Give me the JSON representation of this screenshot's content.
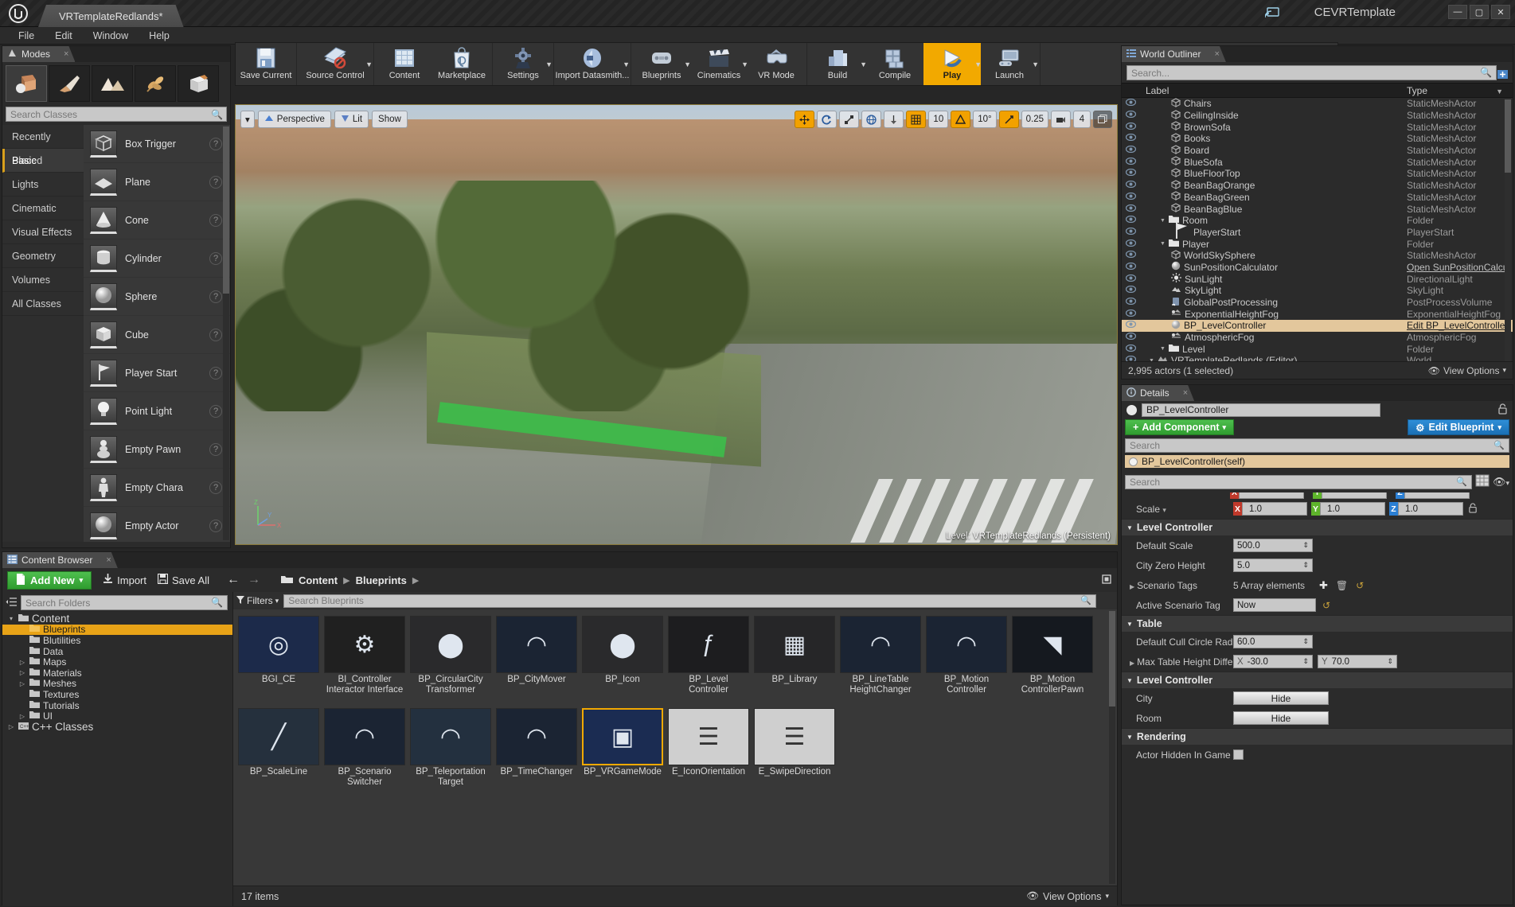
{
  "window": {
    "project_tab": "VRTemplateRedlands*",
    "title_right": "CEVRTemplate",
    "logo": "unreal-logo",
    "buttons": {
      "minimize": "—",
      "maximize": "▢",
      "close": "✕"
    }
  },
  "menu": [
    "File",
    "Edit",
    "Window",
    "Help"
  ],
  "modes": {
    "tab": "Modes",
    "close": "×",
    "mode_icons": [
      "place-mode-icon",
      "paint-mode-icon",
      "landscape-mode-icon",
      "foliage-mode-icon",
      "geometry-edit-mode-icon"
    ],
    "search_placeholder": "Search Classes",
    "categories": [
      "Recently Placed",
      "Basic",
      "Lights",
      "Cinematic",
      "Visual Effects",
      "Geometry",
      "Volumes",
      "All Classes"
    ],
    "active_category": "Basic",
    "items": [
      {
        "name": "Empty Actor",
        "icon": "sphere-icon"
      },
      {
        "name": "Empty Chara",
        "icon": "character-icon"
      },
      {
        "name": "Empty Pawn",
        "icon": "pawn-icon"
      },
      {
        "name": "Point Light",
        "icon": "point-light-icon"
      },
      {
        "name": "Player Start",
        "icon": "player-start-icon"
      },
      {
        "name": "Cube",
        "icon": "cube-icon"
      },
      {
        "name": "Sphere",
        "icon": "sphere-icon"
      },
      {
        "name": "Cylinder",
        "icon": "cylinder-icon"
      },
      {
        "name": "Cone",
        "icon": "cone-icon"
      },
      {
        "name": "Plane",
        "icon": "plane-icon"
      },
      {
        "name": "Box Trigger",
        "icon": "box-trigger-icon"
      }
    ],
    "help_glyph": "?"
  },
  "toolbar": {
    "groups": [
      {
        "items": [
          {
            "label": "Save Current",
            "icon": "floppy-save-icon",
            "caret": false
          }
        ]
      },
      {
        "items": [
          {
            "label": "Source Control",
            "icon": "source-control-icon",
            "caret": true
          }
        ]
      },
      {
        "items": [
          {
            "label": "Content",
            "icon": "content-grid-icon",
            "caret": false
          },
          {
            "label": "Marketplace",
            "icon": "marketplace-bag-icon",
            "caret": false
          }
        ]
      },
      {
        "items": [
          {
            "label": "Settings",
            "icon": "gear-icon",
            "caret": true
          }
        ]
      },
      {
        "items": [
          {
            "label": "Import Datasmith...",
            "icon": "datasmith-icon",
            "caret": true
          }
        ]
      },
      {
        "items": [
          {
            "label": "Blueprints",
            "icon": "blueprint-icon",
            "caret": true
          },
          {
            "label": "Cinematics",
            "icon": "clapperboard-icon",
            "caret": true
          },
          {
            "label": "VR Mode",
            "icon": "vr-mode-icon",
            "caret": false
          }
        ]
      },
      {
        "items": [
          {
            "label": "Build",
            "icon": "build-icon",
            "caret": true
          },
          {
            "label": "Compile",
            "icon": "compile-icon",
            "caret": false
          },
          {
            "label": "Play",
            "icon": "play-icon",
            "caret": true,
            "active": true
          },
          {
            "label": "Launch",
            "icon": "launch-icon",
            "caret": true
          }
        ]
      }
    ]
  },
  "viewport": {
    "left_buttons": [
      "Perspective",
      "Lit",
      "Show"
    ],
    "view_caret": "▾",
    "transform_tools": [
      "translate-icon",
      "rotate-icon",
      "scale-icon"
    ],
    "world_space_icon": "globe-icon",
    "surface_snap_icon": "surface-snap-icon",
    "grid_snap": {
      "icon": "grid-icon",
      "value": "10",
      "on": true
    },
    "angle_snap": {
      "icon": "angle-icon",
      "value": "10°",
      "on": true
    },
    "scale_snap": {
      "icon": "scale-snap-icon",
      "value": "0.25",
      "on": true
    },
    "camera_speed": {
      "icon": "camera-icon",
      "value": "4"
    },
    "maximize_icon": "maximize-viewport-icon",
    "status_prefix": "Level:",
    "status_value": "VRTemplateRedlands (Persistent)"
  },
  "outliner": {
    "tab": "World Outliner",
    "close": "×",
    "search_placeholder": "Search...",
    "add_icon": "add-column-icon",
    "columns": {
      "label": "Label",
      "type": "Type"
    },
    "rows": [
      {
        "label": "VRTemplateRedlands (Editor)",
        "type": "World",
        "indent": 0,
        "icon": "world-icon",
        "expander": "▾"
      },
      {
        "label": "Level",
        "type": "Folder",
        "indent": 1,
        "icon": "folder-icon",
        "expander": "▾"
      },
      {
        "label": "AtmosphericFog",
        "type": "AtmosphericFog",
        "indent": 2,
        "icon": "fog-icon"
      },
      {
        "label": "BP_LevelController",
        "type": "Edit BP_LevelController",
        "indent": 2,
        "icon": "blueprint-ball-icon",
        "selected": true,
        "type_link": true
      },
      {
        "label": "ExponentialHeightFog",
        "type": "ExponentialHeightFog",
        "indent": 2,
        "icon": "fog-icon"
      },
      {
        "label": "GlobalPostProcessing",
        "type": "PostProcessVolume",
        "indent": 2,
        "icon": "postprocess-icon"
      },
      {
        "label": "SkyLight",
        "type": "SkyLight",
        "indent": 2,
        "icon": "skylight-icon"
      },
      {
        "label": "SunLight",
        "type": "DirectionalLight",
        "indent": 2,
        "icon": "sunlight-icon"
      },
      {
        "label": "SunPositionCalculator",
        "type": "Open SunPositionCalcu",
        "indent": 2,
        "icon": "blueprint-ball-icon",
        "type_link": true
      },
      {
        "label": "WorldSkySphere",
        "type": "StaticMeshActor",
        "indent": 2,
        "icon": "mesh-icon"
      },
      {
        "label": "Player",
        "type": "Folder",
        "indent": 1,
        "icon": "folder-icon",
        "expander": "▾"
      },
      {
        "label": "PlayerStart",
        "type": "PlayerStart",
        "indent": 2,
        "icon": "player-start-icon"
      },
      {
        "label": "Room",
        "type": "Folder",
        "indent": 1,
        "icon": "folder-icon",
        "expander": "▾"
      },
      {
        "label": "BeanBagBlue",
        "type": "StaticMeshActor",
        "indent": 2,
        "icon": "mesh-icon"
      },
      {
        "label": "BeanBagGreen",
        "type": "StaticMeshActor",
        "indent": 2,
        "icon": "mesh-icon"
      },
      {
        "label": "BeanBagOrange",
        "type": "StaticMeshActor",
        "indent": 2,
        "icon": "mesh-icon"
      },
      {
        "label": "BlueFloorTop",
        "type": "StaticMeshActor",
        "indent": 2,
        "icon": "mesh-icon"
      },
      {
        "label": "BlueSofa",
        "type": "StaticMeshActor",
        "indent": 2,
        "icon": "mesh-icon"
      },
      {
        "label": "Board",
        "type": "StaticMeshActor",
        "indent": 2,
        "icon": "mesh-icon"
      },
      {
        "label": "Books",
        "type": "StaticMeshActor",
        "indent": 2,
        "icon": "mesh-icon"
      },
      {
        "label": "BrownSofa",
        "type": "StaticMeshActor",
        "indent": 2,
        "icon": "mesh-icon"
      },
      {
        "label": "CeilingInside",
        "type": "StaticMeshActor",
        "indent": 2,
        "icon": "mesh-icon"
      },
      {
        "label": "Chairs",
        "type": "StaticMeshActor",
        "indent": 2,
        "icon": "mesh-icon"
      }
    ],
    "footer_count": "2,995 actors (1 selected)",
    "view_options": "View Options",
    "view_options_icon": "eye-icon"
  },
  "details": {
    "tab": "Details",
    "close": "×",
    "actor_name": "BP_LevelController",
    "lock_icon": "lock-icon",
    "add_component": "Add Component",
    "edit_blueprint": "Edit Blueprint",
    "component_search_placeholder": "Search",
    "component_root": "BP_LevelController(self)",
    "property_search_placeholder": "Search",
    "grid_view_icon": "grid-view-icon",
    "eye_icon": "eye-icon",
    "transform": {
      "label": "Scale",
      "x": "1.0",
      "y": "1.0",
      "z": "1.0"
    },
    "sections": [
      {
        "title": "Level Controller",
        "rows": [
          {
            "label": "Default Scale",
            "kind": "num",
            "value": "500.0"
          },
          {
            "label": "City Zero Height",
            "kind": "num",
            "value": "5.0"
          },
          {
            "label": "Scenario Tags",
            "kind": "array",
            "value": "5 Array elements",
            "expander": "▷"
          },
          {
            "label": "Active Scenario Tag",
            "kind": "text",
            "value": "Now"
          }
        ]
      },
      {
        "title": "Table",
        "rows": [
          {
            "label": "Default Cull Circle Radius",
            "kind": "num",
            "value": "60.0"
          },
          {
            "label": "Max Table Height Difference",
            "kind": "xy",
            "x": "-30.0",
            "y": "70.0",
            "expander": "▷"
          }
        ]
      },
      {
        "title": "Level Controller",
        "rows": [
          {
            "label": "City",
            "kind": "button",
            "value": "Hide"
          },
          {
            "label": "Room",
            "kind": "button",
            "value": "Hide"
          }
        ]
      },
      {
        "title": "Rendering",
        "rows": [
          {
            "label": "Actor Hidden In Game",
            "kind": "check",
            "value": ""
          }
        ]
      }
    ]
  },
  "content_browser": {
    "tab": "Content Browser",
    "close": "×",
    "add_new": "Add New",
    "import": "Import",
    "save_all": "Save All",
    "back_icon": "arrow-left-icon",
    "forward_icon": "arrow-right-icon",
    "breadcrumbs": [
      "Content",
      "Blueprints"
    ],
    "lock_icon": "lock-icon",
    "folder_search_placeholder": "Search Folders",
    "tree_icon": "collapse-tree-icon",
    "folders": [
      {
        "name": "Content",
        "indent": 0,
        "expander": "▾",
        "root": true
      },
      {
        "name": "Blueprints",
        "indent": 1,
        "selected": true
      },
      {
        "name": "Blutilities",
        "indent": 1
      },
      {
        "name": "Data",
        "indent": 1
      },
      {
        "name": "Maps",
        "indent": 1,
        "expander": "▷"
      },
      {
        "name": "Materials",
        "indent": 1,
        "expander": "▷"
      },
      {
        "name": "Meshes",
        "indent": 1,
        "expander": "▷"
      },
      {
        "name": "Textures",
        "indent": 1
      },
      {
        "name": "Tutorials",
        "indent": 1
      },
      {
        "name": "UI",
        "indent": 1,
        "expander": "▷"
      },
      {
        "name": "C++ Classes",
        "indent": 0,
        "expander": "▷",
        "root": true
      }
    ],
    "filters_label": "Filters",
    "asset_search_placeholder": "Search Blueprints",
    "assets": [
      {
        "name": "BGI_CE",
        "thumb": "#1c2a4a",
        "glyph": "◎"
      },
      {
        "name": "BI_Controller Interactor Interface",
        "thumb": "#202020",
        "glyph": "⚙"
      },
      {
        "name": "BP_CircularCity Transformer",
        "thumb": "#2a2a2c",
        "glyph": "⬤"
      },
      {
        "name": "BP_CityMover",
        "thumb": "#1b2433",
        "glyph": "◠"
      },
      {
        "name": "BP_Icon",
        "thumb": "#2a2a2c",
        "glyph": "⬤"
      },
      {
        "name": "BP_Level Controller",
        "thumb": "#1d1d1f",
        "glyph": "ƒ"
      },
      {
        "name": "BP_Library",
        "thumb": "#262628",
        "glyph": "▦"
      },
      {
        "name": "BP_LineTable HeightChanger",
        "thumb": "#1b2433",
        "glyph": "◠"
      },
      {
        "name": "BP_Motion Controller",
        "thumb": "#1b2433",
        "glyph": "◠"
      },
      {
        "name": "BP_Motion ControllerPawn",
        "thumb": "#15191f",
        "glyph": "◥"
      },
      {
        "name": "BP_ScaleLine",
        "thumb": "#25303d",
        "glyph": "╱"
      },
      {
        "name": "BP_Scenario Switcher",
        "thumb": "#1b2433",
        "glyph": "◠"
      },
      {
        "name": "BP_Teleportation Target",
        "thumb": "#23303f",
        "glyph": "◠"
      },
      {
        "name": "BP_TimeChanger",
        "thumb": "#1b2433",
        "glyph": "◠"
      },
      {
        "name": "BP_VRGameMode",
        "thumb": "#1b2c52",
        "glyph": "▣"
      },
      {
        "name": "E_IconOrientation",
        "thumb": "#cfcfcf",
        "glyph": "☰"
      },
      {
        "name": "E_SwipeDirection",
        "thumb": "#cfcfcf",
        "glyph": "☰"
      }
    ],
    "item_count": "17 items",
    "view_options": "View Options",
    "view_options_icon": "eye-icon"
  }
}
